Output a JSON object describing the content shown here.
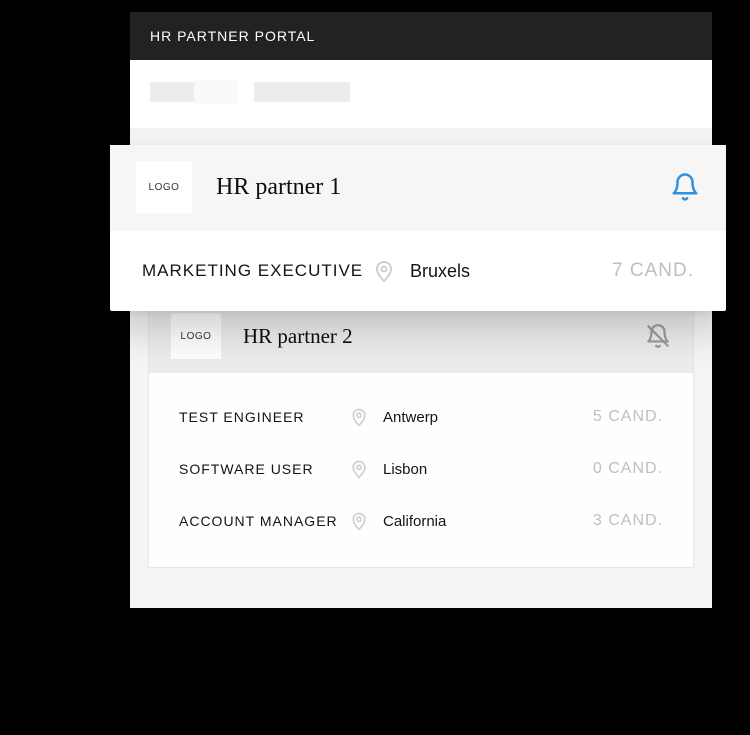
{
  "app": {
    "title": "HR PARTNER PORTAL"
  },
  "logo_label": "LOGO",
  "candidate_suffix": "CAND.",
  "partner1": {
    "name": "HR partner 1",
    "jobs": [
      {
        "title": "MARKETING EXECUTIVE",
        "location": "Bruxels",
        "count": 7
      }
    ]
  },
  "partner2": {
    "name": "HR partner 2",
    "jobs": [
      {
        "title": "TEST ENGINEER",
        "location": "Antwerp",
        "count": 5
      },
      {
        "title": "SOFTWARE USER",
        "location": "Lisbon",
        "count": 0
      },
      {
        "title": "ACCOUNT MANAGER",
        "location": "California",
        "count": 3
      }
    ]
  }
}
